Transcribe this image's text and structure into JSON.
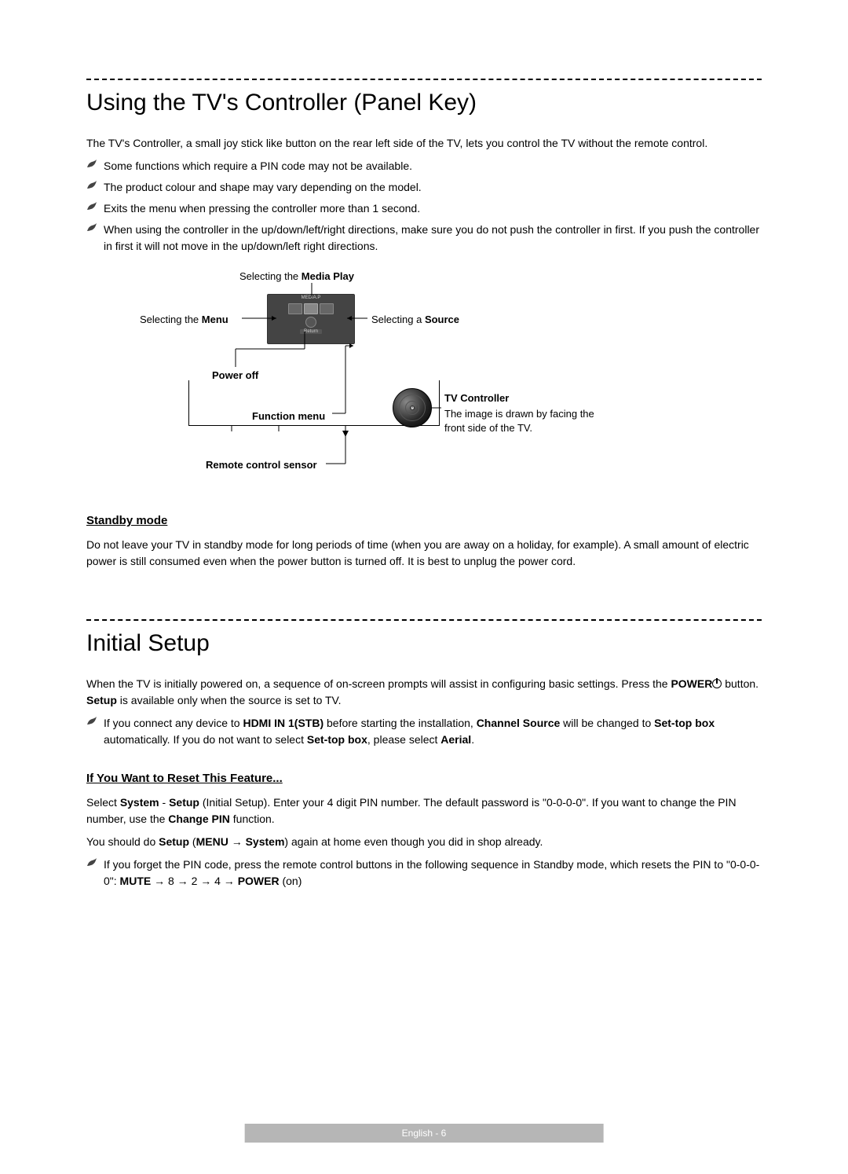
{
  "section1": {
    "title": "Using the TV's Controller (Panel Key)",
    "intro": "The TV's Controller, a small joy stick like button on the rear left side of the TV, lets you control the TV without the remote control.",
    "notes": [
      "Some functions which require a PIN code may not be available.",
      "The product colour and shape may vary depending on the model.",
      "Exits the menu when pressing the controller more than 1 second.",
      "When using the controller in the up/down/left/right directions, make sure you do not push the controller in first. If you push the controller in first it will not move in the up/down/left right directions."
    ]
  },
  "diagram": {
    "selecting_media_play": "Selecting the ",
    "media_play_bold": "Media Play",
    "selecting_menu": "Selecting the ",
    "menu_bold": "Menu",
    "selecting_source": "Selecting a ",
    "source_bold": "Source",
    "power_off": "Power off",
    "function_menu": "Function menu",
    "tv_controller": "TV Controller",
    "tv_controller_desc": "The image is drawn by facing the front side of the TV.",
    "remote_sensor": "Remote control sensor",
    "osd_return": "Return",
    "osd_mediap": "MEDIA.P"
  },
  "standby": {
    "heading": "Standby mode",
    "text": "Do not leave your TV in standby mode for long periods of time (when you are away on a holiday, for example). A small amount of electric power is still consumed even when the power button is turned off. It is best to unplug the power cord."
  },
  "section2": {
    "title": "Initial Setup",
    "intro_1": "When the TV is initially powered on, a sequence of on-screen prompts will assist in configuring basic settings. Press the ",
    "power_bold": "POWER",
    "intro_2": " button. ",
    "setup_bold": "Setup",
    "intro_3": " is available only when the source is set to TV.",
    "note1_1": "If you connect any device to ",
    "note1_hdmi": "HDMI IN 1(STB)",
    "note1_2": " before starting the installation, ",
    "note1_channel": "Channel Source",
    "note1_3": " will be changed to ",
    "note1_settop": "Set-top box",
    "note1_4": " automatically. If you do not want to select ",
    "note1_5": ", please select ",
    "note1_aerial": "Aerial",
    "note1_6": "."
  },
  "reset": {
    "heading": "If You Want to Reset This Feature...",
    "p1_1": "Select ",
    "p1_system": "System",
    "p1_dash": " - ",
    "p1_setup": "Setup",
    "p1_2": " (Initial Setup). Enter your 4 digit PIN number. The default password is \"0-0-0-0\". If you want to change the PIN number, use the ",
    "p1_changepin": "Change PIN",
    "p1_3": " function.",
    "p2_1": "You should do ",
    "p2_setup": "Setup",
    "p2_2": " (",
    "p2_menu": "MENU",
    "p2_arrow": " → ",
    "p2_system": "System",
    "p2_3": ") again at home even though you did in shop already.",
    "note_1": "If you forget the PIN code, press the remote control buttons in the following sequence in Standby mode, which resets the PIN to \"0-0-0-0\": ",
    "note_mute": "MUTE",
    "note_seq": " → 8 → 2 → 4 → ",
    "note_power": "POWER",
    "note_on": " (on)"
  },
  "footer": "English - 6"
}
